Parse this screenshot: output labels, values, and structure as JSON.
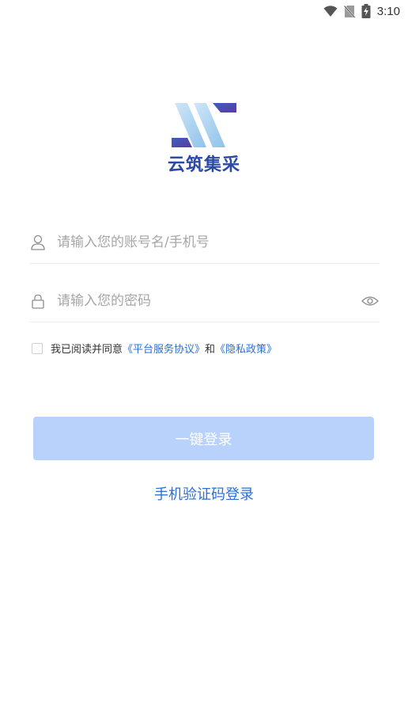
{
  "status_bar": {
    "time": "3:10",
    "icons": [
      "wifi-icon",
      "no-sim-icon",
      "battery-charging-icon"
    ]
  },
  "logo": {
    "text": "云筑集采",
    "colors": {
      "dark_blue": "#2a4aa6",
      "light_blue": "#a9d2f0"
    }
  },
  "form": {
    "account_placeholder": "请输入您的账号名/手机号",
    "account_value": "",
    "password_placeholder": "请输入您的密码",
    "password_value": ""
  },
  "agreement": {
    "prefix": "我已阅读并同意",
    "service_link": "《平台服务协议》",
    "connector": "和",
    "privacy_link": "《隐私政策》",
    "checked": false
  },
  "buttons": {
    "login": "一键登录",
    "sms_login": "手机验证码登录"
  },
  "colors": {
    "accent": "#2b6fd6",
    "button_disabled": "#b9d2fb",
    "divider": "#ececec",
    "placeholder": "#a6a6a6"
  }
}
